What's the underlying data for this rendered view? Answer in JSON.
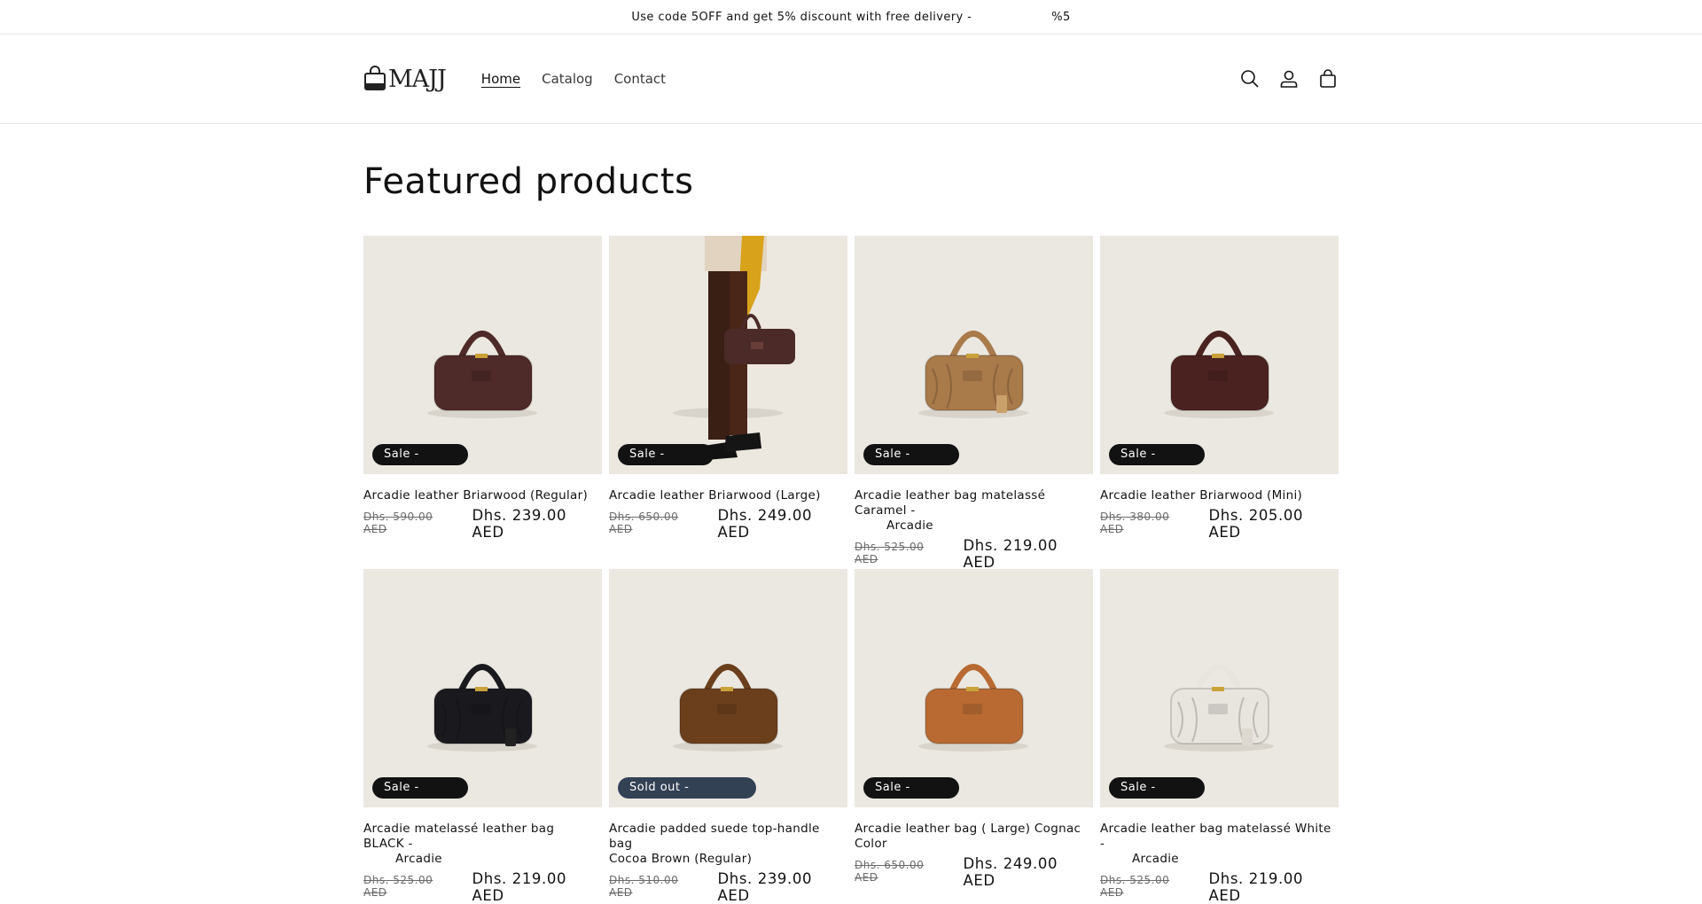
{
  "announcement": {
    "text": "Use code 5OFF and get 5% discount with free delivery -",
    "suffix": "%5"
  },
  "header": {
    "logo_text": "MAJJ",
    "nav": [
      {
        "label": "Home",
        "active": true
      },
      {
        "label": "Catalog",
        "active": false
      },
      {
        "label": "Contact",
        "active": false
      }
    ],
    "icons": [
      "search-icon",
      "account-icon",
      "cart-icon"
    ]
  },
  "section": {
    "title": "Featured products"
  },
  "colors": {
    "text": "#121212",
    "badge_sale": "#121212",
    "badge_sold": "#334155",
    "image_bg": "#ebe8e1"
  },
  "products": [
    {
      "title_line1": "Arcadie leather Briarwood (Regular)",
      "title_line2": "",
      "old_price": "Dhs. 590.00 AED",
      "price": "Dhs. 239.00 AED",
      "badge": "Sale -",
      "bag_color": "#4e2a28",
      "image": "briarwood bag"
    },
    {
      "title_line1": "Arcadie leather Briarwood (Large)",
      "title_line2": "",
      "old_price": "Dhs. 650.00 AED",
      "price": "Dhs. 249.00 AED",
      "badge": "Sale -",
      "bag_color": "#4b2a27",
      "image": "model holding bag"
    },
    {
      "title_line1": "Arcadie leather bag matelassé Caramel -",
      "title_line2": "Arcadie",
      "old_price": "Dhs. 525.00 AED",
      "price": "Dhs. 219.00 AED",
      "badge": "Sale -",
      "bag_color": "#a97a4a",
      "image": "caramel bag"
    },
    {
      "title_line1": "Arcadie leather Briarwood (Mini)",
      "title_line2": "",
      "old_price": "Dhs. 380.00 AED",
      "price": "Dhs. 205.00 AED",
      "badge": "Sale -",
      "bag_color": "#4a2320",
      "image": "mini bag"
    },
    {
      "title_line1": "Arcadie matelassé leather bag BLACK -",
      "title_line2": "Arcadie",
      "old_price": "Dhs. 525.00 AED",
      "price": "Dhs. 219.00 AED",
      "badge": "Sale -",
      "bag_color": "#1a1a1e",
      "image": "black bag"
    },
    {
      "title_line1": "Arcadie padded suede top-handle bag",
      "title_line2": "Cocoa Brown (Regular)",
      "old_price": "Dhs. 510.00 AED",
      "price": "Dhs. 239.00 AED",
      "badge": "Sold out -",
      "bag_color": "#6b3f1c",
      "image": "suede bag"
    },
    {
      "title_line1": "Arcadie leather bag ( Large) Cognac Color",
      "title_line2": "",
      "old_price": "Dhs. 650.00 AED",
      "price": "Dhs. 249.00 AED",
      "badge": "Sale -",
      "bag_color": "#b86a32",
      "image": "cognac bag"
    },
    {
      "title_line1": "Arcadie leather bag matelassé White -",
      "title_line2": "Arcadie",
      "old_price": "Dhs. 525.00 AED",
      "price": "Dhs. 219.00 AED",
      "badge": "Sale -",
      "bag_color": "#e8e4de",
      "image": "white bag"
    }
  ]
}
